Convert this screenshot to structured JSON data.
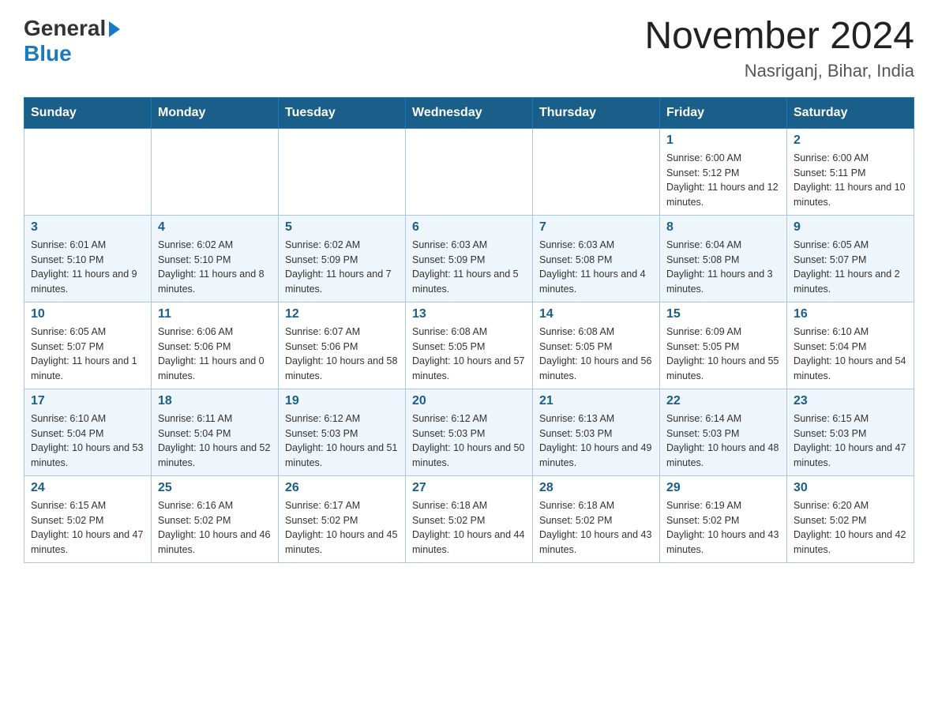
{
  "header": {
    "logo_general": "General",
    "logo_blue": "Blue",
    "month_title": "November 2024",
    "location": "Nasriganj, Bihar, India"
  },
  "weekdays": [
    "Sunday",
    "Monday",
    "Tuesday",
    "Wednesday",
    "Thursday",
    "Friday",
    "Saturday"
  ],
  "weeks": [
    [
      {
        "day": "",
        "sunrise": "",
        "sunset": "",
        "daylight": "",
        "empty": true
      },
      {
        "day": "",
        "sunrise": "",
        "sunset": "",
        "daylight": "",
        "empty": true
      },
      {
        "day": "",
        "sunrise": "",
        "sunset": "",
        "daylight": "",
        "empty": true
      },
      {
        "day": "",
        "sunrise": "",
        "sunset": "",
        "daylight": "",
        "empty": true
      },
      {
        "day": "",
        "sunrise": "",
        "sunset": "",
        "daylight": "",
        "empty": true
      },
      {
        "day": "1",
        "sunrise": "Sunrise: 6:00 AM",
        "sunset": "Sunset: 5:12 PM",
        "daylight": "Daylight: 11 hours and 12 minutes.",
        "empty": false
      },
      {
        "day": "2",
        "sunrise": "Sunrise: 6:00 AM",
        "sunset": "Sunset: 5:11 PM",
        "daylight": "Daylight: 11 hours and 10 minutes.",
        "empty": false
      }
    ],
    [
      {
        "day": "3",
        "sunrise": "Sunrise: 6:01 AM",
        "sunset": "Sunset: 5:10 PM",
        "daylight": "Daylight: 11 hours and 9 minutes.",
        "empty": false
      },
      {
        "day": "4",
        "sunrise": "Sunrise: 6:02 AM",
        "sunset": "Sunset: 5:10 PM",
        "daylight": "Daylight: 11 hours and 8 minutes.",
        "empty": false
      },
      {
        "day": "5",
        "sunrise": "Sunrise: 6:02 AM",
        "sunset": "Sunset: 5:09 PM",
        "daylight": "Daylight: 11 hours and 7 minutes.",
        "empty": false
      },
      {
        "day": "6",
        "sunrise": "Sunrise: 6:03 AM",
        "sunset": "Sunset: 5:09 PM",
        "daylight": "Daylight: 11 hours and 5 minutes.",
        "empty": false
      },
      {
        "day": "7",
        "sunrise": "Sunrise: 6:03 AM",
        "sunset": "Sunset: 5:08 PM",
        "daylight": "Daylight: 11 hours and 4 minutes.",
        "empty": false
      },
      {
        "day": "8",
        "sunrise": "Sunrise: 6:04 AM",
        "sunset": "Sunset: 5:08 PM",
        "daylight": "Daylight: 11 hours and 3 minutes.",
        "empty": false
      },
      {
        "day": "9",
        "sunrise": "Sunrise: 6:05 AM",
        "sunset": "Sunset: 5:07 PM",
        "daylight": "Daylight: 11 hours and 2 minutes.",
        "empty": false
      }
    ],
    [
      {
        "day": "10",
        "sunrise": "Sunrise: 6:05 AM",
        "sunset": "Sunset: 5:07 PM",
        "daylight": "Daylight: 11 hours and 1 minute.",
        "empty": false
      },
      {
        "day": "11",
        "sunrise": "Sunrise: 6:06 AM",
        "sunset": "Sunset: 5:06 PM",
        "daylight": "Daylight: 11 hours and 0 minutes.",
        "empty": false
      },
      {
        "day": "12",
        "sunrise": "Sunrise: 6:07 AM",
        "sunset": "Sunset: 5:06 PM",
        "daylight": "Daylight: 10 hours and 58 minutes.",
        "empty": false
      },
      {
        "day": "13",
        "sunrise": "Sunrise: 6:08 AM",
        "sunset": "Sunset: 5:05 PM",
        "daylight": "Daylight: 10 hours and 57 minutes.",
        "empty": false
      },
      {
        "day": "14",
        "sunrise": "Sunrise: 6:08 AM",
        "sunset": "Sunset: 5:05 PM",
        "daylight": "Daylight: 10 hours and 56 minutes.",
        "empty": false
      },
      {
        "day": "15",
        "sunrise": "Sunrise: 6:09 AM",
        "sunset": "Sunset: 5:05 PM",
        "daylight": "Daylight: 10 hours and 55 minutes.",
        "empty": false
      },
      {
        "day": "16",
        "sunrise": "Sunrise: 6:10 AM",
        "sunset": "Sunset: 5:04 PM",
        "daylight": "Daylight: 10 hours and 54 minutes.",
        "empty": false
      }
    ],
    [
      {
        "day": "17",
        "sunrise": "Sunrise: 6:10 AM",
        "sunset": "Sunset: 5:04 PM",
        "daylight": "Daylight: 10 hours and 53 minutes.",
        "empty": false
      },
      {
        "day": "18",
        "sunrise": "Sunrise: 6:11 AM",
        "sunset": "Sunset: 5:04 PM",
        "daylight": "Daylight: 10 hours and 52 minutes.",
        "empty": false
      },
      {
        "day": "19",
        "sunrise": "Sunrise: 6:12 AM",
        "sunset": "Sunset: 5:03 PM",
        "daylight": "Daylight: 10 hours and 51 minutes.",
        "empty": false
      },
      {
        "day": "20",
        "sunrise": "Sunrise: 6:12 AM",
        "sunset": "Sunset: 5:03 PM",
        "daylight": "Daylight: 10 hours and 50 minutes.",
        "empty": false
      },
      {
        "day": "21",
        "sunrise": "Sunrise: 6:13 AM",
        "sunset": "Sunset: 5:03 PM",
        "daylight": "Daylight: 10 hours and 49 minutes.",
        "empty": false
      },
      {
        "day": "22",
        "sunrise": "Sunrise: 6:14 AM",
        "sunset": "Sunset: 5:03 PM",
        "daylight": "Daylight: 10 hours and 48 minutes.",
        "empty": false
      },
      {
        "day": "23",
        "sunrise": "Sunrise: 6:15 AM",
        "sunset": "Sunset: 5:03 PM",
        "daylight": "Daylight: 10 hours and 47 minutes.",
        "empty": false
      }
    ],
    [
      {
        "day": "24",
        "sunrise": "Sunrise: 6:15 AM",
        "sunset": "Sunset: 5:02 PM",
        "daylight": "Daylight: 10 hours and 47 minutes.",
        "empty": false
      },
      {
        "day": "25",
        "sunrise": "Sunrise: 6:16 AM",
        "sunset": "Sunset: 5:02 PM",
        "daylight": "Daylight: 10 hours and 46 minutes.",
        "empty": false
      },
      {
        "day": "26",
        "sunrise": "Sunrise: 6:17 AM",
        "sunset": "Sunset: 5:02 PM",
        "daylight": "Daylight: 10 hours and 45 minutes.",
        "empty": false
      },
      {
        "day": "27",
        "sunrise": "Sunrise: 6:18 AM",
        "sunset": "Sunset: 5:02 PM",
        "daylight": "Daylight: 10 hours and 44 minutes.",
        "empty": false
      },
      {
        "day": "28",
        "sunrise": "Sunrise: 6:18 AM",
        "sunset": "Sunset: 5:02 PM",
        "daylight": "Daylight: 10 hours and 43 minutes.",
        "empty": false
      },
      {
        "day": "29",
        "sunrise": "Sunrise: 6:19 AM",
        "sunset": "Sunset: 5:02 PM",
        "daylight": "Daylight: 10 hours and 43 minutes.",
        "empty": false
      },
      {
        "day": "30",
        "sunrise": "Sunrise: 6:20 AM",
        "sunset": "Sunset: 5:02 PM",
        "daylight": "Daylight: 10 hours and 42 minutes.",
        "empty": false
      }
    ]
  ]
}
